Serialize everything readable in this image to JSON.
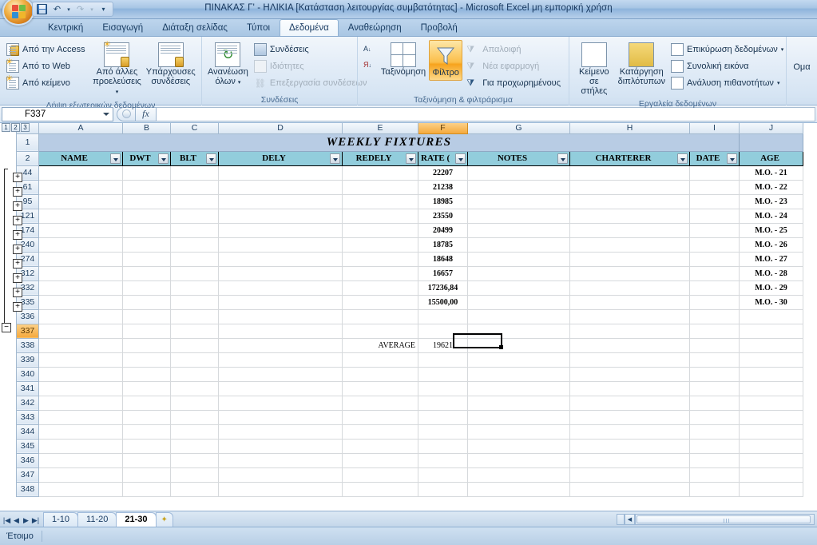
{
  "window": {
    "title": "ΠΙΝΑΚΑΣ Γ' - ΗΛΙΚΙΑ  [Κατάσταση λειτουργίας συμβατότητας] - Microsoft Excel μη εμπορική χρήση"
  },
  "quick_access": {
    "save": "save-icon",
    "undo": "undo-icon",
    "redo": "redo-icon",
    "customize": "customize-icon"
  },
  "ribbon": {
    "tabs": [
      {
        "label": "Κεντρική",
        "active": false
      },
      {
        "label": "Εισαγωγή",
        "active": false
      },
      {
        "label": "Διάταξη σελίδας",
        "active": false
      },
      {
        "label": "Τύποι",
        "active": false
      },
      {
        "label": "Δεδομένα",
        "active": true
      },
      {
        "label": "Αναθεώρηση",
        "active": false
      },
      {
        "label": "Προβολή",
        "active": false
      }
    ],
    "groups": [
      {
        "label": "Λήψη εξωτερικών δεδομένων",
        "small_buttons": [
          {
            "label": "Από την Access",
            "disabled": false
          },
          {
            "label": "Από το Web",
            "disabled": false
          },
          {
            "label": "Από κείμενο",
            "disabled": false
          }
        ],
        "big_buttons": [
          {
            "label_line1": "Από άλλες",
            "label_line2": "προελεύσεις",
            "dropdown": true
          },
          {
            "label_line1": "Υπάρχουσες",
            "label_line2": "συνδέσεις",
            "dropdown": false
          }
        ]
      },
      {
        "label": "Συνδέσεις",
        "big_buttons": [
          {
            "label_line1": "Ανανέωση",
            "label_line2": "όλων",
            "dropdown": true
          }
        ],
        "small_buttons": [
          {
            "label": "Συνδέσεις",
            "disabled": false
          },
          {
            "label": "Ιδιότητες",
            "disabled": true
          },
          {
            "label": "Επεξεργασία συνδέσεων",
            "disabled": true
          }
        ]
      },
      {
        "label": "Ταξινόμηση & φιλτράρισμα",
        "sort_az": "sort-ascending-icon",
        "sort_za": "sort-descending-icon",
        "big_buttons": [
          {
            "label_line1": "Ταξινόμηση",
            "label_line2": "",
            "dropdown": false,
            "active": false
          },
          {
            "label_line1": "Φίλτρο",
            "label_line2": "",
            "dropdown": false,
            "active": true
          }
        ],
        "small_buttons": [
          {
            "label": "Απαλοιφή",
            "disabled": true
          },
          {
            "label": "Νέα εφαρμογή",
            "disabled": true
          },
          {
            "label": "Για προχωρημένους",
            "disabled": false
          }
        ]
      },
      {
        "label": "Εργαλεία δεδομένων",
        "big_buttons": [
          {
            "label_line1": "Κείμενο",
            "label_line2": "σε στήλες",
            "dropdown": false
          },
          {
            "label_line1": "Κατάργηση",
            "label_line2": "διπλότυπων",
            "dropdown": false
          }
        ],
        "small_buttons": [
          {
            "label": "Επικύρωση δεδομένων",
            "disabled": false,
            "dropdown": true
          },
          {
            "label": "Συνολική εικόνα",
            "disabled": false,
            "dropdown": false
          },
          {
            "label": "Ανάλυση πιθανοτήτων",
            "disabled": false,
            "dropdown": true
          }
        ]
      },
      {
        "label": "",
        "truncated_label": "Ομα"
      }
    ]
  },
  "formula_bar": {
    "name_box_value": "F337",
    "formula_value": "",
    "fx_label": "fx"
  },
  "outline": {
    "levels": [
      "1",
      "2",
      "3"
    ],
    "expand_buttons": 10,
    "collapse_button": "−"
  },
  "sheet": {
    "columns": [
      "A",
      "B",
      "C",
      "D",
      "E",
      "F",
      "G",
      "H",
      "I",
      "J"
    ],
    "selected_column": "F",
    "selected_row": "337",
    "selected_cell": "F337",
    "title_row": {
      "row_number": "1",
      "text": "WEEKLY FIXTURES"
    },
    "header_row": {
      "row_number": "2",
      "headers": [
        "NAME",
        "DWT",
        "BLT",
        "DELY",
        "REDELY",
        "RATE  (",
        "NOTES",
        "CHARTERER",
        "DATE",
        "AGE"
      ]
    },
    "data_rows": [
      {
        "row": "44",
        "rate": "22207",
        "age": "M.O. - 21"
      },
      {
        "row": "61",
        "rate": "21238",
        "age": "M.O. - 22"
      },
      {
        "row": "95",
        "rate": "18985",
        "age": "M.O. - 23"
      },
      {
        "row": "121",
        "rate": "23550",
        "age": "M.O. - 24"
      },
      {
        "row": "174",
        "rate": "20499",
        "age": "M.O. - 25"
      },
      {
        "row": "240",
        "rate": "18785",
        "age": "M.O. - 26"
      },
      {
        "row": "274",
        "rate": "18648",
        "age": "M.O. - 27"
      },
      {
        "row": "312",
        "rate": "16657",
        "age": "M.O. - 28"
      },
      {
        "row": "332",
        "rate": "17236,84",
        "age": "M.O. - 29"
      },
      {
        "row": "335",
        "rate": "15500,00",
        "age": "M.O. - 30"
      }
    ],
    "blank_rows_after": [
      "336",
      "337",
      "338",
      "339",
      "340",
      "341",
      "342",
      "343",
      "344",
      "345",
      "346",
      "347",
      "348"
    ],
    "average_row": {
      "row": "338",
      "label": "AVERAGE",
      "value": "19621"
    }
  },
  "sheet_tabs": {
    "nav": {
      "first": "|◀",
      "prev": "◀",
      "next": "▶",
      "last": "▶|"
    },
    "tabs": [
      {
        "label": "1-10",
        "active": false
      },
      {
        "label": "11-20",
        "active": false
      },
      {
        "label": "21-30",
        "active": true
      }
    ],
    "new_sheet": "new-sheet-icon"
  },
  "status_bar": {
    "state": "Έτοιμο"
  },
  "colors": {
    "title_row_fill": "#b8cce4",
    "header_row_fill": "#92cddc",
    "selection_highlight": "#f5a93c",
    "filter_active": "#f7a31c"
  }
}
